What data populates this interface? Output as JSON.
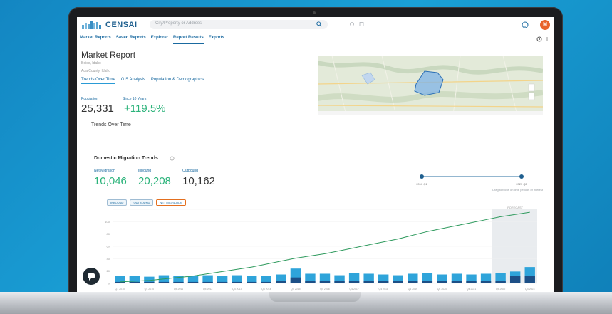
{
  "app": {
    "brand": "CENSAI",
    "search_placeholder": "City/Property or Address"
  },
  "nav": {
    "tabs": [
      "Market Reports",
      "Saved Reports",
      "Explorer",
      "Report Results",
      "Exports"
    ],
    "active_tab": "Report Results"
  },
  "report": {
    "title": "Market Report",
    "subtitle_1": "Boise, Idaho",
    "subtitle_2": "Ada County, Idaho",
    "tabs": [
      "Trends Over Time",
      "GIS Analysis",
      "Population & Demographics"
    ],
    "active_tab": "Trends Over Time"
  },
  "metrics_top": [
    {
      "label": "Population",
      "value": "25,331"
    },
    {
      "label": "Since 10 Years",
      "value": "+119.5%"
    }
  ],
  "section_title": "Trends Over Time",
  "domestic": {
    "title": "Domestic Migration Trends",
    "metrics": [
      {
        "label": "Net Migration",
        "value": "10,046"
      },
      {
        "label": "Inbound",
        "value": "20,208"
      },
      {
        "label": "Outbound",
        "value": "10,162"
      }
    ],
    "slider": {
      "start": "2010 Q1",
      "end": "2023 Q2",
      "caption": "Drag to focus on time periods of interest"
    },
    "filters": [
      "INBOUND",
      "OUTBOUND",
      "NET MIGRATION"
    ]
  },
  "chart_data": {
    "type": "bar",
    "categories": [
      "Q1 2010",
      "Q2 2010",
      "Q4 2010",
      "Q2 2011",
      "Q4 2011",
      "Q2 2012",
      "Q4 2012",
      "Q2 2013",
      "Q4 2013",
      "Q2 2014",
      "Q4 2014",
      "Q2 2015",
      "Q4 2015",
      "Q2 2016",
      "Q4 2016",
      "Q2 2017",
      "Q4 2017",
      "Q2 2018",
      "Q4 2018",
      "Q2 2019",
      "Q4 2019",
      "Q2 2020",
      "Q4 2020",
      "Q2 2021",
      "Q4 2021",
      "Q2 2022",
      "Q4 2022",
      "Q2 2023",
      "Q4 2023"
    ],
    "series": [
      {
        "name": "Inbound",
        "values": [
          10,
          10,
          9,
          11,
          10,
          10,
          11,
          10,
          11,
          10,
          10,
          12,
          20,
          13,
          13,
          11,
          14,
          13,
          12,
          11,
          13,
          14,
          12,
          13,
          12,
          13,
          14,
          16,
          22
        ]
      },
      {
        "name": "Outbound",
        "values": [
          2,
          2,
          2,
          2,
          2,
          2,
          2,
          2,
          2,
          2,
          2,
          3,
          8,
          3,
          3,
          3,
          3,
          3,
          3,
          3,
          3,
          3,
          3,
          3,
          3,
          3,
          3,
          10,
          10
        ]
      },
      {
        "name": "Net Migration",
        "values": [
          2,
          3,
          4,
          6,
          8,
          10,
          13,
          16,
          19,
          22,
          26,
          30,
          34,
          37,
          40,
          44,
          48,
          52,
          56,
          60,
          65,
          70,
          74,
          78,
          82,
          86,
          90,
          93,
          96
        ]
      }
    ],
    "y_ticks": [
      "",
      "100",
      "80",
      "60",
      "40",
      "20",
      "0"
    ],
    "highlight_label": "FORECAST"
  },
  "colors": {
    "accent": "#1a6aa0",
    "bar": "#2fa4da",
    "bar_dark": "#1d4f86",
    "line": "#2e9a5d",
    "green": "#2bb37a"
  }
}
